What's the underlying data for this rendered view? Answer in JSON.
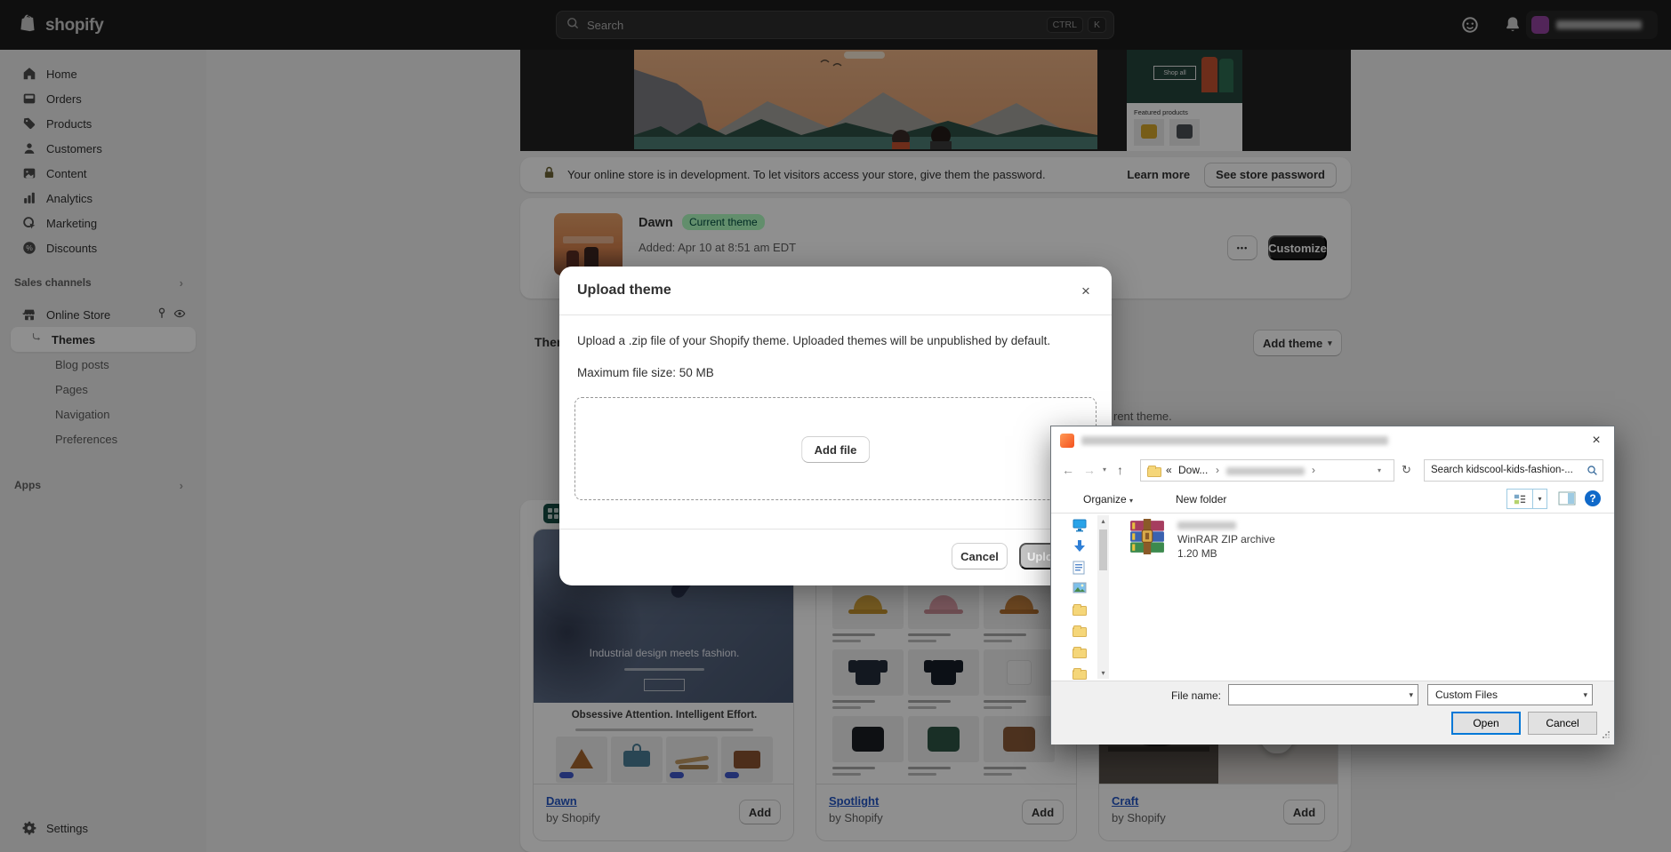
{
  "topbar": {
    "logo_text": "shopify",
    "search_label": "Search",
    "shortcut_ctrl": "CTRL",
    "shortcut_k": "K"
  },
  "sidebar": {
    "items": [
      "Home",
      "Orders",
      "Products",
      "Customers",
      "Content",
      "Analytics",
      "Marketing",
      "Discounts"
    ],
    "sales_channels_label": "Sales channels",
    "online_store_label": "Online Store",
    "online_store_children": [
      "Themes",
      "Blog posts",
      "Pages",
      "Navigation",
      "Preferences"
    ],
    "apps_label": "Apps",
    "settings_label": "Settings"
  },
  "banner": {
    "message": "Your online store is in development. To let visitors access your store, give them the password.",
    "learn_more_label": "Learn more",
    "see_password_label": "See store password"
  },
  "current_theme": {
    "name": "Dawn",
    "badge": "Current theme",
    "added_text": "Added: Apr 10 at 8:51 am EDT",
    "customize_label": "Customize",
    "more_label": "•••"
  },
  "library": {
    "title": "Theme library",
    "add_theme_label": "Add theme",
    "description_visible_fragment": "rent theme."
  },
  "upload_modal": {
    "title": "Upload theme",
    "description": "Upload a .zip file of your Shopify theme. Uploaded themes will be unpublished by default.",
    "max_file_size": "Maximum file size: 50 MB",
    "add_file_label": "Add file",
    "cancel_label": "Cancel",
    "upload_label": "Upload"
  },
  "theme_preview": {
    "shop_all_label": "Shop all",
    "featured_products_label": "Featured products"
  },
  "theme_cards": [
    {
      "name": "Dawn",
      "author": "by Shopify",
      "add_label": "Add",
      "hero_text": "Industrial design meets fashion.",
      "section_heading": "Obsessive Attention. Intelligent Effort."
    },
    {
      "name": "Spotlight",
      "author": "by Shopify",
      "add_label": "Add"
    },
    {
      "name": "Craft",
      "author": "by Shopify",
      "add_label": "Add"
    }
  ],
  "file_dialog": {
    "breadcrumb_prefix": "«",
    "breadcrumb_folder": "Dow...",
    "separator": "›",
    "search_text": "Search kidscool-kids-fashion-...",
    "toolbar": {
      "organize_label": "Organize",
      "new_folder_label": "New folder"
    },
    "file_item": {
      "type": "WinRAR ZIP archive",
      "size": "1.20 MB"
    },
    "footer": {
      "file_name_label": "File name:",
      "file_type_value": "Custom Files",
      "open_label": "Open",
      "cancel_label": "Cancel"
    }
  },
  "icons": {
    "chevron_down": "▾",
    "back_arrow": "←",
    "forward_arrow": "→",
    "up_arrow": "↑",
    "refresh": "↻",
    "close": "×",
    "help": "?",
    "scroll_up": "▴",
    "scroll_down": "▾",
    "header_chevron": "›"
  }
}
